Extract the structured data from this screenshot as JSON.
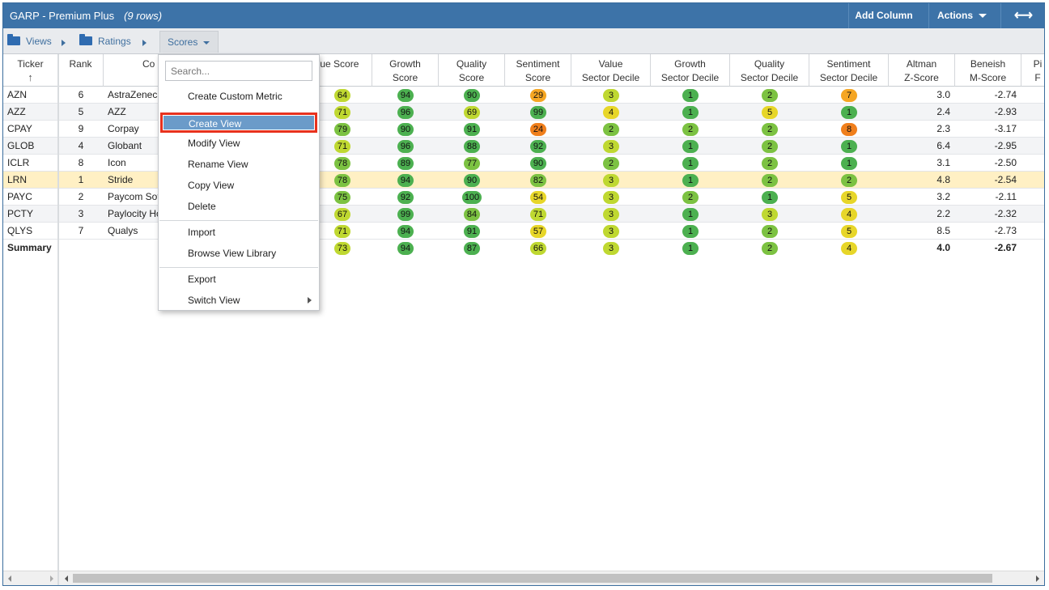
{
  "header": {
    "title": "GARP - Premium Plus",
    "rows_label": "(9 rows)",
    "add_column_label": "Add Column",
    "actions_label": "Actions",
    "expand_icon": "horizontal-expand-icon"
  },
  "breadcrumb": {
    "views_label": "Views",
    "ratings_label": "Ratings",
    "scores_label": "Scores"
  },
  "columns": {
    "ticker": "Ticker",
    "rank": "Rank",
    "company": "Co",
    "value_score": "alue Score",
    "growth_score_1": "Growth",
    "growth_score_2": "Score",
    "quality_score_1": "Quality",
    "quality_score_2": "Score",
    "sentiment_score_1": "Sentiment",
    "sentiment_score_2": "Score",
    "value_decile_1": "Value",
    "value_decile_2": "Sector Decile",
    "growth_decile_1": "Growth",
    "growth_decile_2": "Sector Decile",
    "quality_decile_1": "Quality",
    "quality_decile_2": "Sector Decile",
    "sentiment_decile_1": "Sentiment",
    "sentiment_decile_2": "Sector Decile",
    "altman_1": "Altman",
    "altman_2": "Z-Score",
    "beneish_1": "Beneish",
    "beneish_2": "M-Score",
    "pi_1": "Pi",
    "pi_2": "F"
  },
  "rows": [
    {
      "ticker": "AZN",
      "rank": "6",
      "company": "AstraZeneca",
      "value": "64",
      "growth": "94",
      "quality": "90",
      "sentiment": "29",
      "vd": "3",
      "gd": "1",
      "qd": "2",
      "sd": "7",
      "altman": "3.0",
      "beneish": "-2.74"
    },
    {
      "ticker": "AZZ",
      "rank": "5",
      "company": "AZZ",
      "value": "71",
      "growth": "96",
      "quality": "69",
      "sentiment": "99",
      "vd": "4",
      "gd": "1",
      "qd": "5",
      "sd": "1",
      "altman": "2.4",
      "beneish": "-2.93"
    },
    {
      "ticker": "CPAY",
      "rank": "9",
      "company": "Corpay",
      "value": "79",
      "growth": "90",
      "quality": "91",
      "sentiment": "24",
      "vd": "2",
      "gd": "2",
      "qd": "2",
      "sd": "8",
      "altman": "2.3",
      "beneish": "-3.17"
    },
    {
      "ticker": "GLOB",
      "rank": "4",
      "company": "Globant",
      "value": "71",
      "growth": "96",
      "quality": "88",
      "sentiment": "92",
      "vd": "3",
      "gd": "1",
      "qd": "2",
      "sd": "1",
      "altman": "6.4",
      "beneish": "-2.95"
    },
    {
      "ticker": "ICLR",
      "rank": "8",
      "company": "Icon",
      "value": "78",
      "growth": "89",
      "quality": "77",
      "sentiment": "90",
      "vd": "2",
      "gd": "1",
      "qd": "2",
      "sd": "1",
      "altman": "3.1",
      "beneish": "-2.50"
    },
    {
      "ticker": "LRN",
      "rank": "1",
      "company": "Stride",
      "value": "78",
      "growth": "94",
      "quality": "90",
      "sentiment": "82",
      "vd": "3",
      "gd": "1",
      "qd": "2",
      "sd": "2",
      "altman": "4.8",
      "beneish": "-2.54"
    },
    {
      "ticker": "PAYC",
      "rank": "2",
      "company": "Paycom Software",
      "value": "75",
      "growth": "92",
      "quality": "100",
      "sentiment": "54",
      "vd": "3",
      "gd": "2",
      "qd": "1",
      "sd": "5",
      "altman": "3.2",
      "beneish": "-2.11"
    },
    {
      "ticker": "PCTY",
      "rank": "3",
      "company": "Paylocity Holding",
      "value": "67",
      "growth": "99",
      "quality": "84",
      "sentiment": "71",
      "vd": "3",
      "gd": "1",
      "qd": "3",
      "sd": "4",
      "altman": "2.2",
      "beneish": "-2.32"
    },
    {
      "ticker": "QLYS",
      "rank": "7",
      "company": "Qualys",
      "value": "71",
      "growth": "94",
      "quality": "91",
      "sentiment": "57",
      "vd": "3",
      "gd": "1",
      "qd": "2",
      "sd": "5",
      "altman": "8.5",
      "beneish": "-2.73"
    }
  ],
  "summary": {
    "label": "Summary",
    "value": "73",
    "growth": "94",
    "quality": "87",
    "sentiment": "66",
    "vd": "3",
    "gd": "1",
    "qd": "2",
    "sd": "4",
    "altman": "4.0",
    "beneish": "-2.67"
  },
  "menu": {
    "search_placeholder": "Search...",
    "items": [
      "Create Custom Metric",
      "Create View",
      "Modify View",
      "Rename View",
      "Copy View",
      "Delete",
      "Import",
      "Browse View Library",
      "Export",
      "Switch View"
    ]
  },
  "colors": {
    "header_bg": "#3d73a8",
    "score_dark_green": "#4cb050",
    "score_green": "#7cc242",
    "score_lime": "#bfd831",
    "score_yellow": "#e7d629",
    "score_orange": "#f5a623",
    "score_deep_orange": "#f07f1c",
    "highlight_row": "#fff0c4",
    "annotation_red": "#e8321e"
  }
}
